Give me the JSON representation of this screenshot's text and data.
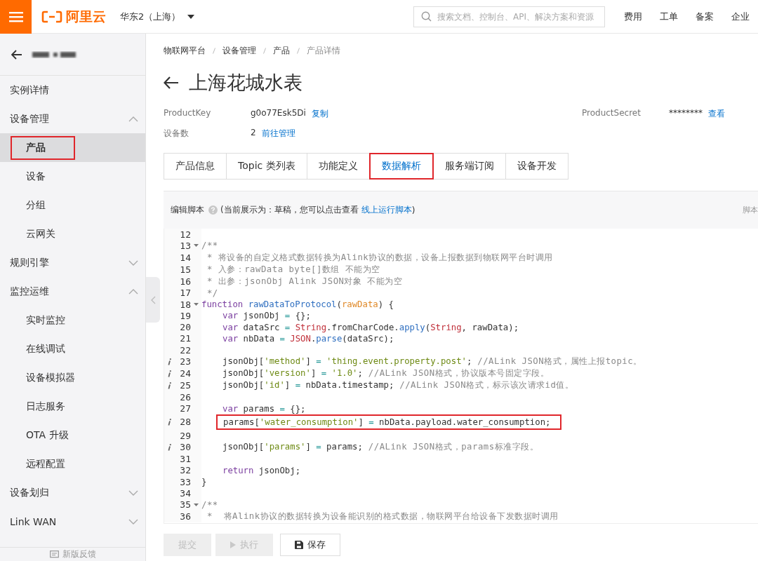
{
  "topbar": {
    "brand": "阿里云",
    "region": "华东2（上海）",
    "search": {
      "placeholder": "搜索文档、控制台、API、解决方案和资源"
    },
    "links": [
      "费用",
      "工单",
      "备案",
      "企业"
    ]
  },
  "sidebar": {
    "items": [
      {
        "kind": "link",
        "label": "实例详情"
      },
      {
        "kind": "group",
        "label": "设备管理",
        "expanded": true,
        "children": [
          {
            "label": "产品",
            "selected": true,
            "annotated": true
          },
          {
            "label": "设备",
            "selected": false,
            "annotated": false
          },
          {
            "label": "分组",
            "selected": false,
            "annotated": false
          },
          {
            "label": "云网关",
            "selected": false,
            "annotated": false
          }
        ]
      },
      {
        "kind": "group",
        "label": "规则引擎",
        "expanded": false
      },
      {
        "kind": "group",
        "label": "监控运维",
        "expanded": true,
        "children": [
          {
            "label": "实时监控",
            "selected": false,
            "annotated": false
          },
          {
            "label": "在线调试",
            "selected": false,
            "annotated": false
          },
          {
            "label": "设备模拟器",
            "selected": false,
            "annotated": false
          },
          {
            "label": "日志服务",
            "selected": false,
            "annotated": false
          },
          {
            "label": "OTA 升级",
            "selected": false,
            "annotated": false
          },
          {
            "label": "远程配置",
            "selected": false,
            "annotated": false
          }
        ]
      },
      {
        "kind": "group",
        "label": "设备划归",
        "expanded": false
      },
      {
        "kind": "group",
        "label": "Link WAN",
        "expanded": false
      }
    ],
    "feedback": "新版反馈"
  },
  "breadcrumb": [
    "物联网平台",
    "设备管理",
    "产品",
    "产品详情"
  ],
  "title": "上海花城水表",
  "info_rows": [
    {
      "fields": [
        {
          "label": "ProductKey",
          "value": "g0o77Esk5Di",
          "link": "复制"
        },
        {
          "label": "ProductSecret",
          "value": "********",
          "link": "查看"
        }
      ]
    },
    {
      "fields": [
        {
          "label": "设备数",
          "value": "2",
          "link": "前往管理"
        }
      ]
    }
  ],
  "tabs": [
    {
      "label": "产品信息",
      "selected": false,
      "annotated": false
    },
    {
      "label": "Topic 类列表",
      "selected": false,
      "annotated": false
    },
    {
      "label": "功能定义",
      "selected": false,
      "annotated": false
    },
    {
      "label": "数据解析",
      "selected": true,
      "annotated": true
    },
    {
      "label": "服务端订阅",
      "selected": false,
      "annotated": false
    },
    {
      "label": "设备开发",
      "selected": false,
      "annotated": false
    }
  ],
  "script_header": {
    "title": "编辑脚本",
    "note_before": "(当前展示为：草稿，您可以点击查看",
    "note_link": "线上运行脚本",
    "note_after": ")",
    "right_label": "脚本"
  },
  "code_lines": [
    {
      "number": "12",
      "fold": false,
      "info": false,
      "annotated": false
    },
    {
      "number": "13",
      "fold": true,
      "info": false,
      "annotated": false,
      "indented": false,
      "tokens": [
        {
          "kind": "comment",
          "text": "/**"
        }
      ]
    },
    {
      "number": "14",
      "fold": false,
      "info": false,
      "annotated": false,
      "indented": false,
      "tokens": [
        {
          "kind": "comment",
          "text": " * 将设备的自定义格式数据转换为Alink协议的数据，设备上报数据到物联网平台时调用"
        }
      ]
    },
    {
      "number": "15",
      "fold": false,
      "info": false,
      "annotated": false,
      "indented": false,
      "tokens": [
        {
          "kind": "comment",
          "text": " * 入参：rawData byte[]数组 不能为空"
        }
      ]
    },
    {
      "number": "16",
      "fold": false,
      "info": false,
      "annotated": false,
      "indented": false,
      "tokens": [
        {
          "kind": "comment",
          "text": " * 出参：jsonObj Alink JSON对象 不能为空"
        }
      ]
    },
    {
      "number": "17",
      "fold": false,
      "info": false,
      "annotated": false,
      "indented": false,
      "tokens": [
        {
          "kind": "comment",
          "text": " */"
        }
      ]
    },
    {
      "number": "18",
      "fold": true,
      "info": false,
      "annotated": false,
      "indented": false,
      "tokens": [
        {
          "kind": "keyword",
          "text": "function"
        },
        {
          "kind": "function",
          "text": " rawDataToProtocol"
        },
        {
          "kind": "plain",
          "text": "("
        },
        {
          "kind": "param",
          "text": "rawData"
        },
        {
          "kind": "plain",
          "text": ") {"
        }
      ]
    },
    {
      "number": "19",
      "fold": false,
      "info": false,
      "annotated": false,
      "indented": true,
      "tokens": [
        {
          "kind": "keyword",
          "text": "var"
        },
        {
          "kind": "plain",
          "text": " jsonObj "
        },
        {
          "kind": "operator",
          "text": "="
        },
        {
          "kind": "plain",
          "text": " {};"
        }
      ]
    },
    {
      "number": "20",
      "fold": false,
      "info": false,
      "annotated": false,
      "indented": true,
      "tokens": [
        {
          "kind": "keyword",
          "text": "var"
        },
        {
          "kind": "plain",
          "text": " dataSrc "
        },
        {
          "kind": "operator",
          "text": "="
        },
        {
          "kind": "builtin",
          "text": " String"
        },
        {
          "kind": "plain",
          "text": ".fromCharCode."
        },
        {
          "kind": "function",
          "text": "apply"
        },
        {
          "kind": "plain",
          "text": "("
        },
        {
          "kind": "builtin",
          "text": "String"
        },
        {
          "kind": "plain",
          "text": ", rawData);"
        }
      ]
    },
    {
      "number": "21",
      "fold": false,
      "info": false,
      "annotated": false,
      "indented": true,
      "tokens": [
        {
          "kind": "keyword",
          "text": "var"
        },
        {
          "kind": "plain",
          "text": " nbData "
        },
        {
          "kind": "operator",
          "text": "="
        },
        {
          "kind": "builtin",
          "text": " JSON"
        },
        {
          "kind": "plain",
          "text": "."
        },
        {
          "kind": "function",
          "text": "parse"
        },
        {
          "kind": "plain",
          "text": "(dataSrc);"
        }
      ]
    },
    {
      "number": "22",
      "fold": false,
      "info": false,
      "annotated": false
    },
    {
      "number": "23",
      "fold": false,
      "info": true,
      "annotated": false,
      "indented": true,
      "tokens": [
        {
          "kind": "plain",
          "text": "jsonObj["
        },
        {
          "kind": "string",
          "text": "'method'"
        },
        {
          "kind": "plain",
          "text": "] "
        },
        {
          "kind": "operator",
          "text": "="
        },
        {
          "kind": "string",
          "text": " 'thing.event.property.post'"
        },
        {
          "kind": "plain",
          "text": ";"
        },
        {
          "kind": "comment",
          "text": " //ALink JSON格式，属性上报topic。"
        }
      ]
    },
    {
      "number": "24",
      "fold": false,
      "info": true,
      "annotated": false,
      "indented": true,
      "tokens": [
        {
          "kind": "plain",
          "text": "jsonObj["
        },
        {
          "kind": "string",
          "text": "'version'"
        },
        {
          "kind": "plain",
          "text": "] "
        },
        {
          "kind": "operator",
          "text": "="
        },
        {
          "kind": "string",
          "text": " '1.0'"
        },
        {
          "kind": "plain",
          "text": ";"
        },
        {
          "kind": "comment",
          "text": " //ALink JSON格式，协议版本号固定字段。"
        }
      ]
    },
    {
      "number": "25",
      "fold": false,
      "info": true,
      "annotated": false,
      "indented": true,
      "tokens": [
        {
          "kind": "plain",
          "text": "jsonObj["
        },
        {
          "kind": "string",
          "text": "'id'"
        },
        {
          "kind": "plain",
          "text": "] "
        },
        {
          "kind": "operator",
          "text": "="
        },
        {
          "kind": "plain",
          "text": " nbData.timestamp;"
        },
        {
          "kind": "comment",
          "text": " //ALink JSON格式，标示该次请求id值。"
        }
      ]
    },
    {
      "number": "26",
      "fold": false,
      "info": false,
      "annotated": false
    },
    {
      "number": "27",
      "fold": false,
      "info": false,
      "annotated": false,
      "indented": true,
      "tokens": [
        {
          "kind": "keyword",
          "text": "var"
        },
        {
          "kind": "plain",
          "text": " params "
        },
        {
          "kind": "operator",
          "text": "="
        },
        {
          "kind": "plain",
          "text": " {};"
        }
      ]
    },
    {
      "number": "28",
      "fold": false,
      "info": true,
      "annotated": true,
      "indented": true,
      "tokens": [
        {
          "kind": "plain",
          "text": "params["
        },
        {
          "kind": "string",
          "text": "'water_consumption'"
        },
        {
          "kind": "plain",
          "text": "] "
        },
        {
          "kind": "operator",
          "text": "="
        },
        {
          "kind": "plain",
          "text": " nbData.payload.water_consumption;"
        }
      ]
    },
    {
      "number": "29",
      "fold": false,
      "info": false,
      "annotated": false
    },
    {
      "number": "30",
      "fold": false,
      "info": true,
      "annotated": false,
      "indented": true,
      "tokens": [
        {
          "kind": "plain",
          "text": "jsonObj["
        },
        {
          "kind": "string",
          "text": "'params'"
        },
        {
          "kind": "plain",
          "text": "] "
        },
        {
          "kind": "operator",
          "text": "="
        },
        {
          "kind": "plain",
          "text": " params;"
        },
        {
          "kind": "comment",
          "text": " //ALink JSON格式，params标准字段。"
        }
      ]
    },
    {
      "number": "31",
      "fold": false,
      "info": false,
      "annotated": false
    },
    {
      "number": "32",
      "fold": false,
      "info": false,
      "annotated": false,
      "indented": true,
      "tokens": [
        {
          "kind": "keyword",
          "text": "return"
        },
        {
          "kind": "plain",
          "text": " jsonObj;"
        }
      ]
    },
    {
      "number": "33",
      "fold": false,
      "info": false,
      "annotated": false,
      "indented": false,
      "tokens": [
        {
          "kind": "plain",
          "text": "}"
        }
      ]
    },
    {
      "number": "34",
      "fold": false,
      "info": false,
      "annotated": false
    },
    {
      "number": "35",
      "fold": true,
      "info": false,
      "annotated": false,
      "indented": false,
      "tokens": [
        {
          "kind": "comment",
          "text": "/**"
        }
      ]
    },
    {
      "number": "36",
      "fold": false,
      "info": false,
      "annotated": false,
      "indented": false,
      "tokens": [
        {
          "kind": "comment",
          "text": " *  将Alink协议的数据转换为设备能识别的格式数据，物联网平台给设备下发数据时调用"
        }
      ]
    }
  ],
  "actions": [
    {
      "kind": "submit",
      "label": "提交",
      "disabled": true
    },
    {
      "kind": "run",
      "label": "执行",
      "disabled": true
    },
    {
      "kind": "save",
      "label": "保存",
      "disabled": false
    }
  ]
}
